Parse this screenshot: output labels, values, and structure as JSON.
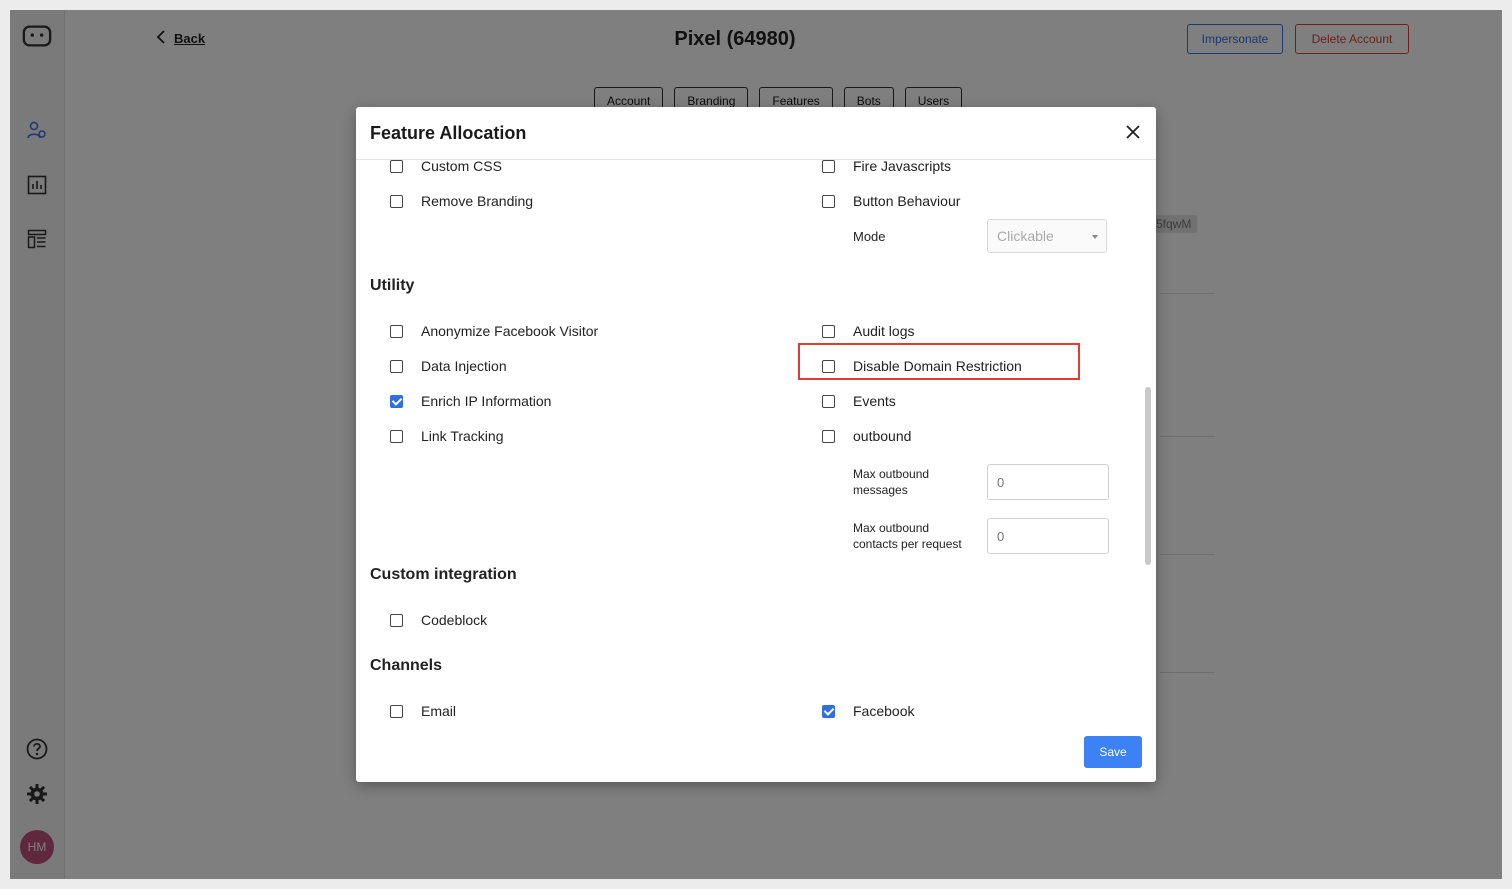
{
  "header": {
    "back_label": "Back",
    "title": "Pixel (64980)",
    "impersonate_label": "Impersonate",
    "delete_label": "Delete Account"
  },
  "tabs": [
    "Account",
    "Branding",
    "Features",
    "Bots",
    "Users"
  ],
  "sidebar": {
    "icons": [
      "users-icon",
      "chart-icon",
      "layout-icon",
      "help-icon",
      "gear-icon"
    ],
    "avatar_initials": "HM"
  },
  "background": {
    "chip_text": "5fqwM"
  },
  "modal": {
    "title": "Feature Allocation",
    "save_label": "Save",
    "top": {
      "custom_css": {
        "label": "Custom CSS",
        "checked": false
      },
      "fire_javascripts": {
        "label": "Fire Javascripts",
        "checked": false
      },
      "remove_branding": {
        "label": "Remove Branding",
        "checked": false
      },
      "button_behaviour": {
        "label": "Button Behaviour",
        "checked": false
      },
      "mode_label": "Mode",
      "mode_value": "Clickable"
    },
    "utility": {
      "title": "Utility",
      "anonymize": {
        "label": "Anonymize Facebook Visitor",
        "checked": false
      },
      "audit_logs": {
        "label": "Audit logs",
        "checked": false
      },
      "data_injection": {
        "label": "Data Injection",
        "checked": false
      },
      "disable_domain": {
        "label": "Disable Domain Restriction",
        "checked": false
      },
      "enrich_ip": {
        "label": "Enrich IP Information",
        "checked": true
      },
      "events": {
        "label": "Events",
        "checked": false
      },
      "link_tracking": {
        "label": "Link Tracking",
        "checked": false
      },
      "outbound": {
        "label": "outbound",
        "checked": false
      },
      "max_messages_label_1": "Max outbound",
      "max_messages_label_2": "messages",
      "max_messages_placeholder": "0",
      "max_contacts_label_1": "Max outbound",
      "max_contacts_label_2": "contacts per request",
      "max_contacts_placeholder": "0"
    },
    "custom_integration": {
      "title": "Custom integration",
      "codeblock": {
        "label": "Codeblock",
        "checked": false
      }
    },
    "channels": {
      "title": "Channels",
      "email": {
        "label": "Email",
        "checked": false
      },
      "facebook": {
        "label": "Facebook",
        "checked": true
      }
    }
  },
  "colors": {
    "accent": "#3d82f5",
    "danger": "#e03d35",
    "checkbox_checked": "#2f6fe0"
  }
}
